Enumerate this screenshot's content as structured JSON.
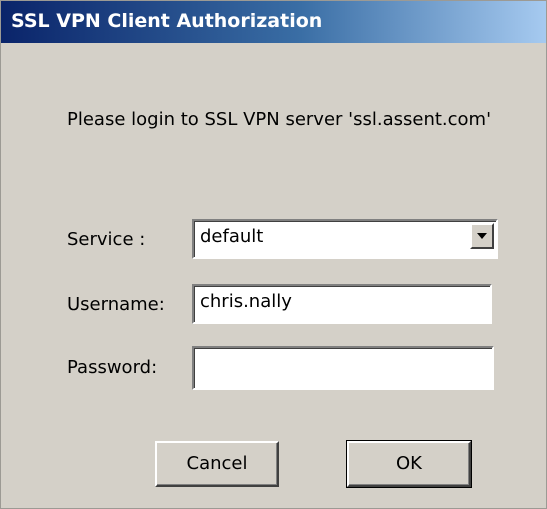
{
  "window": {
    "title": "SSL VPN Client Authorization"
  },
  "prompt": "Please login to SSL VPN server 'ssl.assent.com'",
  "service": {
    "label": "Service :",
    "value": "default",
    "arrow_icon": "chevron-down-icon"
  },
  "username": {
    "label": "Username:",
    "value": "chris.nally"
  },
  "password": {
    "label": "Password:",
    "value": ""
  },
  "buttons": {
    "cancel_label": "Cancel",
    "ok_label": "OK"
  },
  "colors": {
    "dialog_background": "#d4d0c8",
    "titlebar_start": "#0a246a",
    "titlebar_end": "#a6caf0"
  }
}
